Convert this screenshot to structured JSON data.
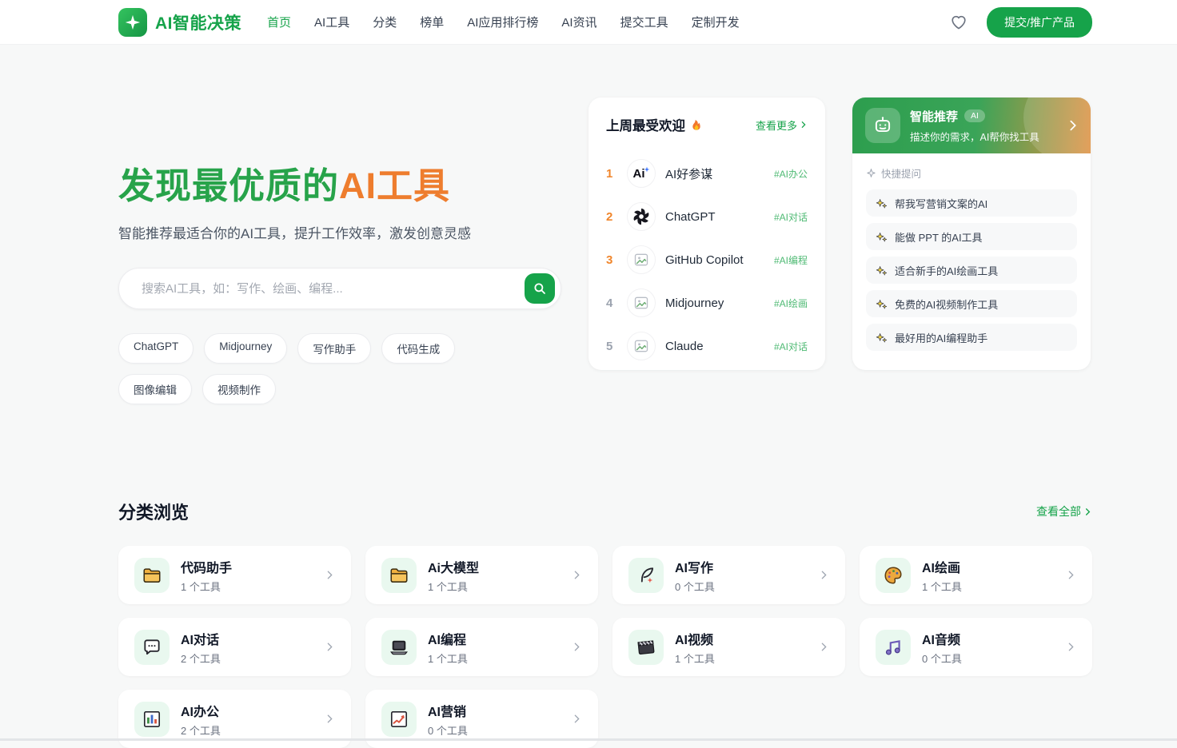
{
  "colors": {
    "brand_green": "#16a34a",
    "title_green": "#27a34a",
    "title_orange": "#ee7d2e",
    "rank_orange": "#f0862c",
    "tag_green": "#4fba74",
    "reco_gradient_start": "#2d9e4e",
    "reco_gradient_end": "#df9142",
    "page_bg": "#f7f8f8"
  },
  "header": {
    "brand": "AI智能决策",
    "nav": [
      {
        "label": "首页"
      },
      {
        "label": "AI工具"
      },
      {
        "label": "分类"
      },
      {
        "label": "榜单"
      },
      {
        "label": "AI应用排行榜"
      },
      {
        "label": "AI资讯"
      },
      {
        "label": "提交工具"
      },
      {
        "label": "定制开发"
      }
    ],
    "submit_button": "提交/推广产品"
  },
  "hero": {
    "title_green": "发现最优质的",
    "title_orange": "AI工具",
    "subtitle": "智能推荐最适合你的AI工具，提升工作效率，激发创意灵感",
    "search_placeholder": "搜索AI工具，如：写作、绘画、编程...",
    "hot_tags": [
      "ChatGPT",
      "Midjourney",
      "写作助手",
      "代码生成",
      "图像编辑",
      "视频制作"
    ]
  },
  "popular": {
    "title": "上周最受欢迎",
    "more_label": "查看更多",
    "items": [
      {
        "rank": "1",
        "name": "AI好参谋",
        "tag": "#AI办公",
        "icon": "ai-text-logo",
        "logo_text": "Ai"
      },
      {
        "rank": "2",
        "name": "ChatGPT",
        "tag": "#AI对话",
        "icon": "openai-logo"
      },
      {
        "rank": "3",
        "name": "GitHub Copilot",
        "tag": "#AI编程",
        "icon": "image-placeholder"
      },
      {
        "rank": "4",
        "name": "Midjourney",
        "tag": "#AI绘画",
        "icon": "image-placeholder"
      },
      {
        "rank": "5",
        "name": "Claude",
        "tag": "#AI对话",
        "icon": "image-placeholder"
      }
    ]
  },
  "recommend": {
    "title": "智能推荐",
    "badge": "AI",
    "subtitle": "描述你的需求，AI帮你找工具",
    "quick_label": "快捷提问",
    "questions": [
      "帮我写营销文案的AI",
      "能做 PPT 的AI工具",
      "适合新手的AI绘画工具",
      "免费的AI视频制作工具",
      "最好用的AI编程助手"
    ]
  },
  "categories": {
    "title": "分类浏览",
    "view_all": "查看全部",
    "items": [
      {
        "name": "代码助手",
        "count": "1 个工具",
        "icon": "folder-icon"
      },
      {
        "name": "Ai大模型",
        "count": "1 个工具",
        "icon": "folder-icon"
      },
      {
        "name": "AI写作",
        "count": "0 个工具",
        "icon": "feather-icon"
      },
      {
        "name": "AI绘画",
        "count": "1 个工具",
        "icon": "palette-icon"
      },
      {
        "name": "AI对话",
        "count": "2 个工具",
        "icon": "chat-bubble-icon"
      },
      {
        "name": "AI编程",
        "count": "1 个工具",
        "icon": "laptop-icon"
      },
      {
        "name": "AI视频",
        "count": "1 个工具",
        "icon": "clapperboard-icon"
      },
      {
        "name": "AI音频",
        "count": "0 个工具",
        "icon": "music-icon"
      },
      {
        "name": "AI办公",
        "count": "2 个工具",
        "icon": "bar-chart-icon"
      },
      {
        "name": "AI营销",
        "count": "0 个工具",
        "icon": "line-chart-icon"
      }
    ]
  }
}
